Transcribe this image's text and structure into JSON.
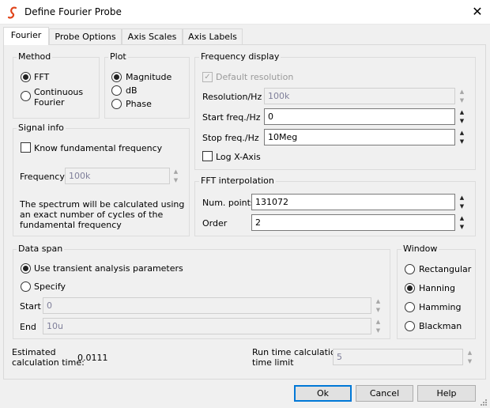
{
  "window": {
    "title": "Define Fourier Probe",
    "close_icon": "close-icon"
  },
  "tabs": [
    {
      "label": "Fourier",
      "active": true
    },
    {
      "label": "Probe Options",
      "active": false
    },
    {
      "label": "Axis Scales",
      "active": false
    },
    {
      "label": "Axis Labels",
      "active": false
    }
  ],
  "method": {
    "title": "Method",
    "options": [
      {
        "label": "FFT",
        "selected": true
      },
      {
        "label": "Continuous Fourier",
        "selected": false
      }
    ]
  },
  "plot": {
    "title": "Plot",
    "options": [
      {
        "label": "Magnitude",
        "selected": true
      },
      {
        "label": "dB",
        "selected": false
      },
      {
        "label": "Phase",
        "selected": false
      }
    ]
  },
  "signal_info": {
    "title": "Signal info",
    "know_fundamental_label": "Know fundamental frequency",
    "frequency_label": "Frequency",
    "frequency_value": "100k",
    "note": "The spectrum will be calculated using an exact number of cycles of the  fundamental frequency"
  },
  "frequency_display": {
    "title": "Frequency display",
    "default_resolution_label": "Default resolution",
    "resolution_label": "Resolution/Hz",
    "resolution_value": "100k",
    "start_label": "Start freq./Hz",
    "start_value": "0",
    "stop_label": "Stop freq./Hz",
    "stop_value": "10Meg",
    "log_x_label": "Log X-Axis"
  },
  "fft_interpolation": {
    "title": "FFT interpolation",
    "num_points_label": "Num. points",
    "num_points_value": "131072",
    "order_label": "Order",
    "order_value": "2"
  },
  "data_span": {
    "title": "Data span",
    "use_transient_label": "Use transient analysis parameters",
    "specify_label": "Specify",
    "start_label": "Start",
    "start_value": "0",
    "end_label": "End",
    "end_value": "10u"
  },
  "window_fn": {
    "title": "Window",
    "options": [
      {
        "label": "Rectangular",
        "selected": false
      },
      {
        "label": "Hanning",
        "selected": true
      },
      {
        "label": "Hamming",
        "selected": false
      },
      {
        "label": "Blackman",
        "selected": false
      }
    ]
  },
  "estimate": {
    "label_line1": "Estimated",
    "label_line2": "calculation time:",
    "value": "0.0111"
  },
  "runtime_limit": {
    "label_line1": "Run time calculation",
    "label_line2": "time limit",
    "value": "5"
  },
  "buttons": {
    "ok": "Ok",
    "cancel": "Cancel",
    "help": "Help"
  },
  "colors": {
    "accent": "#0078d7",
    "app_icon": "#e0441a"
  }
}
